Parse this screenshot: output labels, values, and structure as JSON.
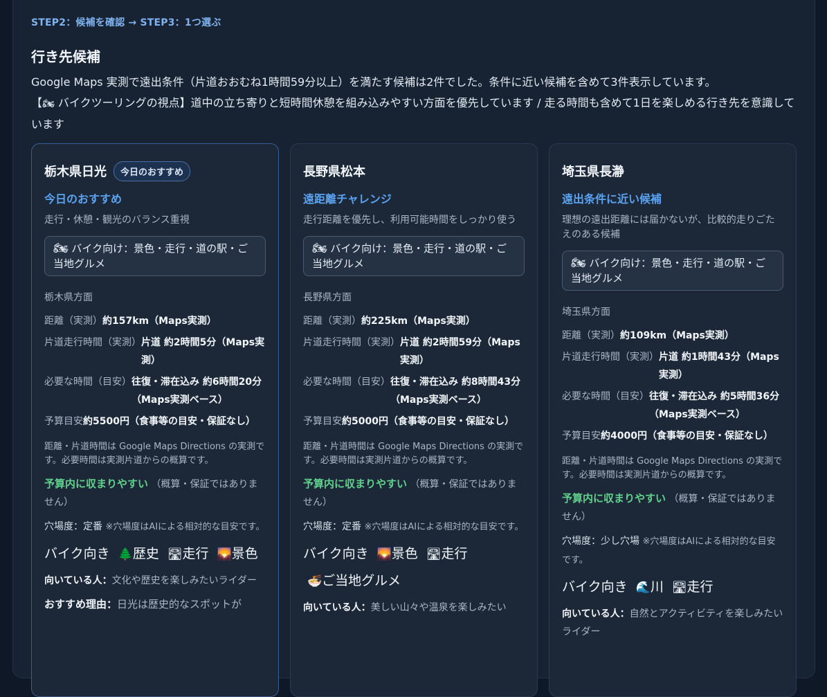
{
  "header": {
    "step": "STEP2：候補を確認 → STEP3：1つ選ぶ",
    "title": "行き先候補",
    "intro_line1": "Google Maps 実測で遠出条件（片道おおむね1時間59分以上）を満たす候補は2件でした。条件に近い候補を含めて3件表示しています。",
    "intro_line2_open": "【",
    "intro_line2_icon": "🏍",
    "intro_line2_text": " バイクツーリングの視点】道中の立ち寄りと短時間休憩を組み込みやすい方面を優先しています / 走る時間も含めて1日を楽しめる行き先を意識しています"
  },
  "labels": {
    "bike_box_icon": "🏍",
    "distance": "距離（実測）",
    "oneway": "片道走行時間（実測）",
    "total": "必要な時間（目安）",
    "budget": "予算目安",
    "note": "距離・片道時間は Google Maps Directions の実測です。必要時間は実測片道からの概算です。",
    "budget_ok": "予算内に収まりやすい",
    "budget_ok_note": "（概算・保証ではありません）",
    "anaba_prefix": "穴場度：",
    "anaba_note": "※穴場度はAIによる相対的な目安です。",
    "bike_prefix": "バイク向き",
    "who_prefix": "向いている人：",
    "reason_prefix": "おすすめ理由："
  },
  "cards": [
    {
      "title": "栃木県日光",
      "badge": "今日のおすすめ",
      "category": "今日のおすすめ",
      "description": "走行・休憩・観光のバランス重視",
      "bike_box": "バイク向け：景色・走行・道の駅・ご当地グルメ",
      "region": "栃木県方面",
      "distance": "約157km（Maps実測）",
      "oneway": "片道 約2時間5分（Maps実測）",
      "total": "往復・滞在込み 約6時間20分（Maps実測ベース）",
      "budget": "約5500円（食事等の目安・保証なし）",
      "anaba_level": "定番",
      "tags": [
        {
          "icon": "🌲",
          "label": "歴史"
        },
        {
          "icon": "🛣",
          "label": "走行"
        },
        {
          "icon": "🌄",
          "label": "景色"
        }
      ],
      "who": "文化や歴史を楽しみたいライダー",
      "reason": "日光は歴史的なスポットが"
    },
    {
      "title": "長野県松本",
      "badge": "",
      "category": "遠距離チャレンジ",
      "description": "走行距離を優先し、利用可能時間をしっかり使う",
      "bike_box": "バイク向け：景色・走行・道の駅・ご当地グルメ",
      "region": "長野県方面",
      "distance": "約225km（Maps実測）",
      "oneway": "片道 約2時間59分（Maps実測）",
      "total": "往復・滞在込み 約8時間43分（Maps実測ベース）",
      "budget": "約5000円（食事等の目安・保証なし）",
      "anaba_level": "定番",
      "tags": [
        {
          "icon": "🌄",
          "label": "景色"
        },
        {
          "icon": "🛣",
          "label": "走行"
        },
        {
          "icon": "🍜",
          "label": "ご当地グルメ"
        }
      ],
      "who": "美しい山々や温泉を楽しみたい",
      "reason": ""
    },
    {
      "title": "埼玉県長瀞",
      "badge": "",
      "category": "遠出条件に近い候補",
      "description": "理想の遠出距離には届かないが、比較的走りごたえのある候補",
      "bike_box": "バイク向け：景色・走行・道の駅・ご当地グルメ",
      "region": "埼玉県方面",
      "distance": "約109km（Maps実測）",
      "oneway": "片道 約1時間43分（Maps実測）",
      "total": "往復・滞在込み 約5時間36分（Maps実測ベース）",
      "budget": "約4000円（食事等の目安・保証なし）",
      "anaba_level": "少し穴場",
      "tags": [
        {
          "icon": "🌊",
          "label": "川"
        },
        {
          "icon": "🛣",
          "label": "走行"
        }
      ],
      "who": "自然とアクティビティを楽しみたいライダー",
      "reason": ""
    }
  ]
}
